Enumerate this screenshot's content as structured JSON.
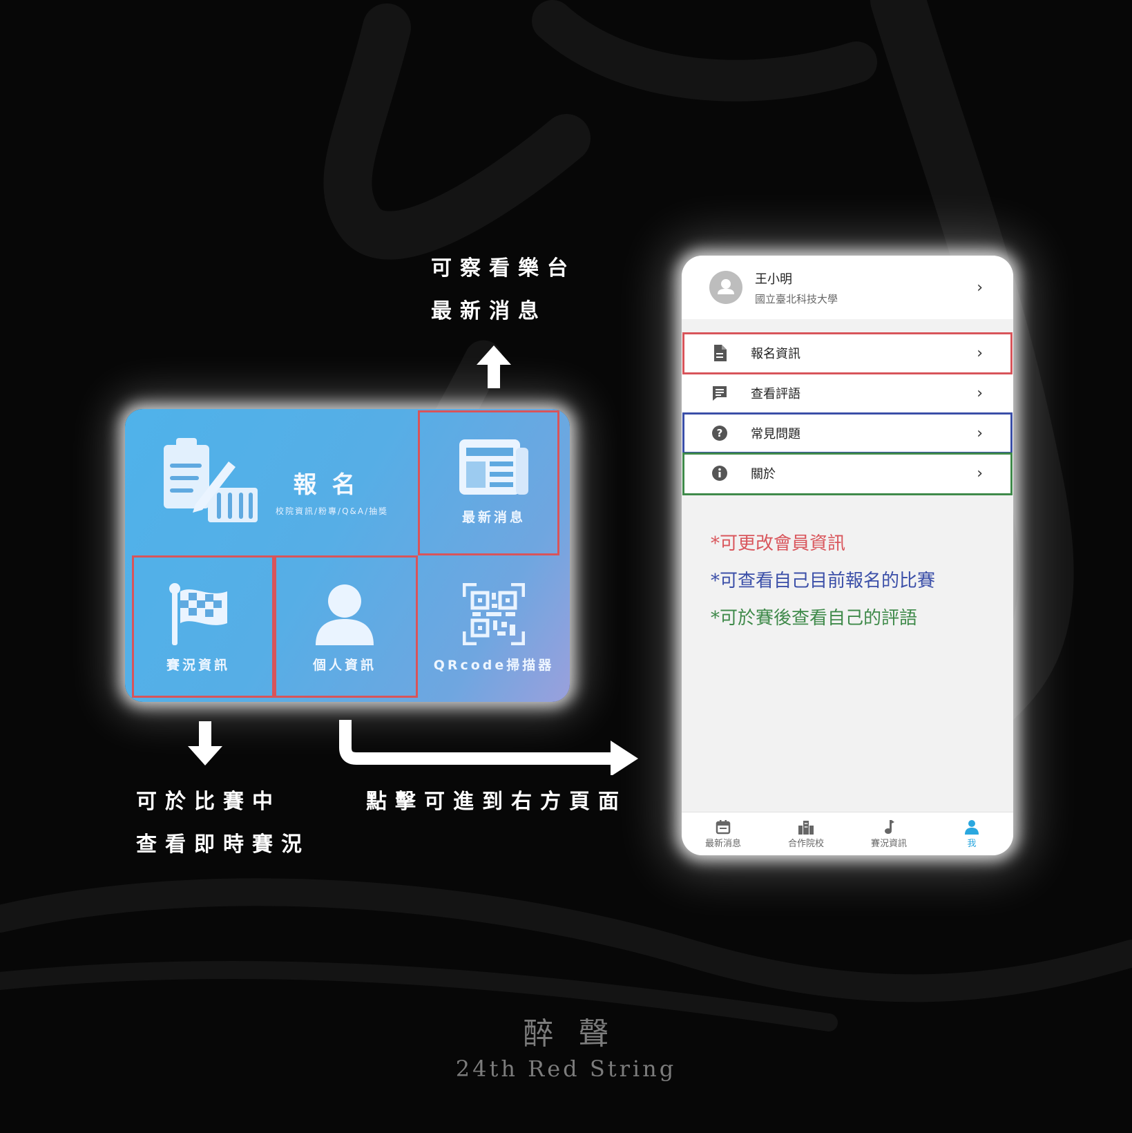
{
  "captions": {
    "top_line1": "可察看樂台",
    "top_line2": "最新消息",
    "left_line1": "可於比賽中",
    "left_line2": "查看即時賽況",
    "right": "點擊可進到右方頁面"
  },
  "card": {
    "signup_title": "報名",
    "signup_sub": "校院資訊/粉專/Q&A/抽獎",
    "news_label": "最新消息",
    "race_label": "賽況資訊",
    "profile_label": "個人資訊",
    "qr_label": "QRcode掃描器"
  },
  "phone": {
    "user_name": "王小明",
    "user_school": "國立臺北科技大學",
    "menu": [
      {
        "label": "報名資訊",
        "icon": "document-icon"
      },
      {
        "label": "查看評語",
        "icon": "comment-icon"
      },
      {
        "label": "常見問題",
        "icon": "help-icon"
      },
      {
        "label": "關於",
        "icon": "info-icon"
      }
    ],
    "notes": [
      {
        "text": "*可更改會員資訊",
        "color": "#d9565c"
      },
      {
        "text": "*可查看自己目前報名的比賽",
        "color": "#3b4fa8"
      },
      {
        "text": "*可於賽後查看自己的評語",
        "color": "#3f8a4a"
      }
    ],
    "tabs": [
      {
        "label": "最新消息",
        "icon": "calendar-icon"
      },
      {
        "label": "合作院校",
        "icon": "building-icon"
      },
      {
        "label": "賽況資訊",
        "icon": "music-note-icon"
      },
      {
        "label": "我",
        "icon": "person-icon"
      }
    ]
  },
  "colors": {
    "highlight_red": "#d8545a",
    "highlight_blue": "#3b4fa8",
    "highlight_green": "#3f8a4a",
    "active_tab": "#2aa7df"
  },
  "footer": {
    "title": "醉聲",
    "subtitle": "24th Red String"
  }
}
